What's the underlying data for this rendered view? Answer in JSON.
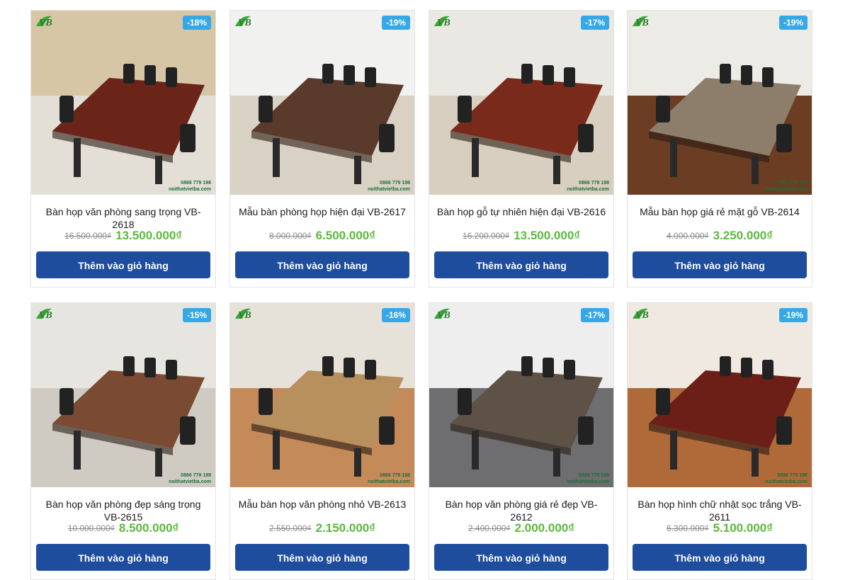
{
  "products": [
    {
      "name": "Bàn họp văn phòng sang trọng VB-2618",
      "old_price": "16.500.000₫",
      "new_price": "13.500.000₫",
      "discount": "-18%",
      "phone": "0866 779 198",
      "site": "noithatvietba.com",
      "button": "Thêm vào giỏ hàng",
      "table_color": "#6b2418",
      "floor_color": "#e3dfd6",
      "wall_color": "#d6c6a6"
    },
    {
      "name": "Mẫu bàn phòng họp hiện đại VB-2617",
      "old_price": "8.000.000₫",
      "new_price": "6.500.000₫",
      "discount": "-19%",
      "phone": "0866 779 198",
      "site": "noithatvietba.com",
      "button": "Thêm vào giỏ hàng",
      "table_color": "#5a3a2a",
      "floor_color": "#d9d2c4",
      "wall_color": "#f1f1f0"
    },
    {
      "name": "Bàn họp gỗ tự nhiên hiện đại VB-2616",
      "old_price": "16.200.000₫",
      "new_price": "13.500.000₫",
      "discount": "-17%",
      "phone": "0866 779 198",
      "site": "noithatvietba.com",
      "button": "Thêm vào giỏ hàng",
      "table_color": "#7a2a1a",
      "floor_color": "#d8cfc0",
      "wall_color": "#e9e8e2"
    },
    {
      "name": "Mẫu bàn họp giá rẻ mặt gỗ VB-2614",
      "old_price": "4.000.000₫",
      "new_price": "3.250.000₫",
      "discount": "-19%",
      "phone": "0866 779 198",
      "site": "noithatvietba.com",
      "button": "Thêm vào giỏ hàng",
      "table_color": "#8d7e6c",
      "floor_color": "#6b3e24",
      "wall_color": "#ecebe6"
    },
    {
      "name": "Bàn họp văn phòng đẹp sáng trọng VB-2615",
      "old_price": "10.000.000₫",
      "new_price": "8.500.000₫",
      "discount": "-15%",
      "phone": "0866 779 198",
      "site": "noithatvietba.com",
      "button": "Thêm vào giỏ hàng",
      "table_color": "#7a4a32",
      "floor_color": "#cfcbc3",
      "wall_color": "#e7e5df"
    },
    {
      "name": "Mẫu bàn họp văn phòng nhỏ VB-2613",
      "old_price": "2.550.000₫",
      "new_price": "2.150.000₫",
      "discount": "-16%",
      "phone": "0866 779 198",
      "site": "noithatvietba.com",
      "button": "Thêm vào giỏ hàng",
      "table_color": "#b8905e",
      "floor_color": "#c48a5a",
      "wall_color": "#e6e2da"
    },
    {
      "name": "Bàn họp văn phòng giá rẻ đẹp VB-2612",
      "old_price": "2.400.000₫",
      "new_price": "2.000.000₫",
      "discount": "-17%",
      "phone": "0866 779 198",
      "site": "noithatvietba.com",
      "button": "Thêm vào giỏ hàng",
      "table_color": "#5e5246",
      "floor_color": "#6e6e70",
      "wall_color": "#eeeeee"
    },
    {
      "name": "Bàn họp hình chữ nhật sọc trắng VB-2611",
      "old_price": "6.300.000₫",
      "new_price": "5.100.000₫",
      "discount": "-19%",
      "phone": "0866 779 198",
      "site": "noithatvietba.com",
      "button": "Thêm vào giỏ hàng",
      "table_color": "#6b1f16",
      "floor_color": "#b06a3a",
      "wall_color": "#efe9e2"
    }
  ],
  "logo_text": "VB",
  "colors": {
    "accent": "#1d4d9c",
    "price": "#5cb83e",
    "badge": "#37a8e6"
  }
}
